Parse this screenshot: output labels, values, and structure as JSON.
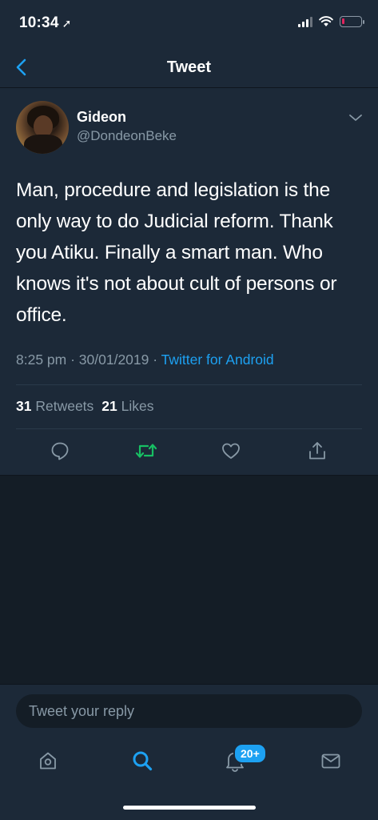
{
  "status_bar": {
    "time": "10:34",
    "location_icon": "location-arrow-icon",
    "signal_icon": "cellular-signal-icon",
    "wifi_icon": "wifi-icon",
    "battery_icon": "battery-low-icon",
    "battery_level": 0.1
  },
  "header": {
    "title": "Tweet",
    "back_icon": "chevron-left-icon"
  },
  "tweet": {
    "author_name": "Gideon",
    "author_handle": "@DondeonBeke",
    "text": "Man, procedure and legislation is the only way to do Judicial reform. Thank you Atiku. Finally a smart man. Who knows it's not about cult of persons or office.",
    "timestamp": "8:25 pm · 30/01/2019 · ",
    "source": "Twitter for Android",
    "retweets_count": "31",
    "retweets_label": "Retweets",
    "likes_count": "21",
    "likes_label": "Likes",
    "retweeted": true
  },
  "reply": {
    "placeholder": "Tweet your reply"
  },
  "tab_bar": {
    "notifications_badge": "20+",
    "active_tab": "search"
  },
  "colors": {
    "accent": "#1da1f2",
    "retweet_active": "#17bf63",
    "background": "#141d26",
    "card": "#1c2938",
    "secondary_text": "#8899a6"
  }
}
